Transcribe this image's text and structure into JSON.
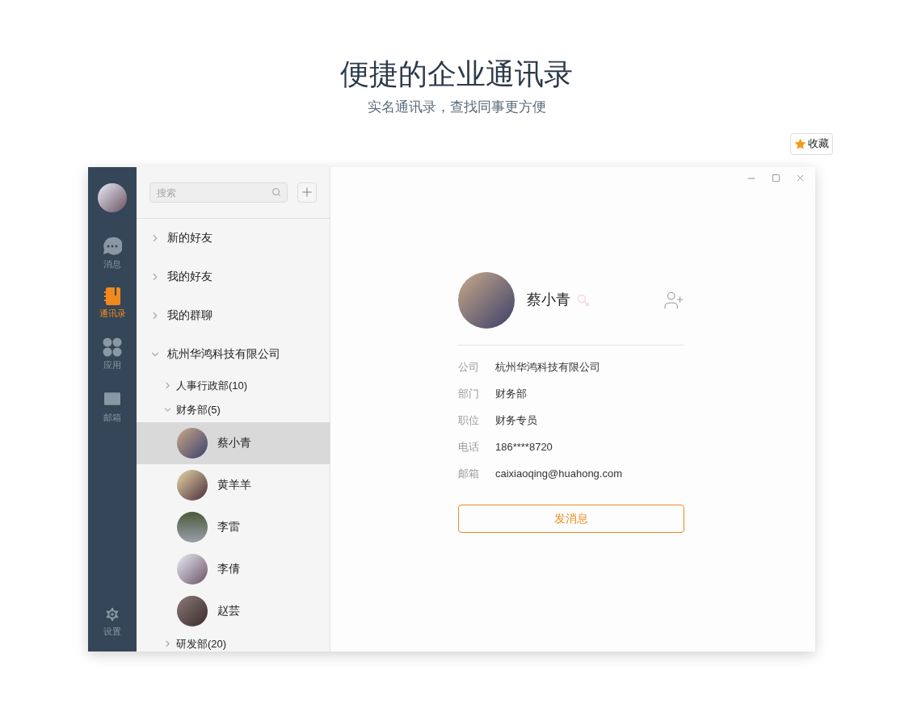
{
  "header": {
    "title": "便捷的企业通讯录",
    "subtitle": "实名通讯录，查找同事更方便"
  },
  "favorite_button": {
    "label": "收藏"
  },
  "nav": {
    "items": [
      {
        "kind": "message",
        "label": "消息",
        "selected": false
      },
      {
        "kind": "contacts",
        "label": "通讯录",
        "selected": true
      },
      {
        "kind": "apps",
        "label": "应用",
        "selected": false
      },
      {
        "kind": "mail",
        "label": "邮箱",
        "selected": false
      }
    ],
    "settings": {
      "label": "设置"
    }
  },
  "search": {
    "placeholder": "搜索"
  },
  "tree": [
    {
      "label": "新的好友",
      "expanded": false
    },
    {
      "label": "我的好友",
      "expanded": false
    },
    {
      "label": "我的群聊",
      "expanded": false
    },
    {
      "label": "杭州华鸿科技有限公司",
      "expanded": true,
      "children": [
        {
          "label": "人事行政部(10)",
          "expanded": false
        },
        {
          "label": "财务部(5)",
          "expanded": true,
          "children": [
            {
              "name": "蔡小青",
              "selected": true
            },
            {
              "name": "黄羊羊",
              "selected": false
            },
            {
              "name": "李雷",
              "selected": false
            },
            {
              "name": "李倩",
              "selected": false
            },
            {
              "name": "赵芸",
              "selected": false
            }
          ]
        },
        {
          "label": "研发部(20)",
          "expanded": false
        }
      ]
    }
  ],
  "profile": {
    "name": "蔡小青",
    "female": true,
    "fields": [
      {
        "label": "公司",
        "value": "杭州华鸿科技有限公司"
      },
      {
        "label": "部门",
        "value": "财务部"
      },
      {
        "label": "职位",
        "value": "财务专员"
      },
      {
        "label": "电话",
        "value": "186****8720"
      },
      {
        "label": "邮箱",
        "value": "caixiaoqing@huahong.com"
      }
    ],
    "button": "发消息"
  }
}
